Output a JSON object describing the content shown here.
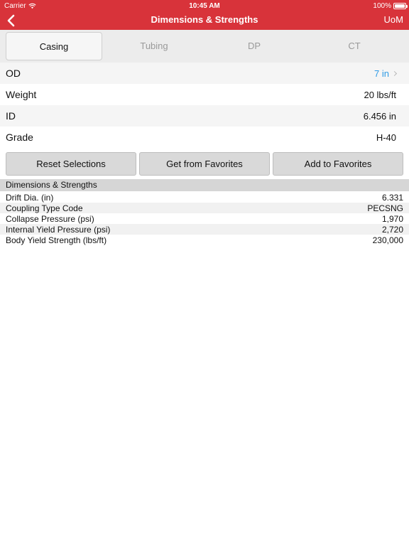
{
  "status_bar": {
    "carrier": "Carrier",
    "time": "10:45 AM",
    "battery": "100%"
  },
  "nav": {
    "title": "Dimensions & Strengths",
    "right_label": "UoM",
    "back_icon": "chevron-left-icon"
  },
  "segments": [
    {
      "label": "Casing",
      "active": true
    },
    {
      "label": "Tubing",
      "active": false
    },
    {
      "label": "DP",
      "active": false
    },
    {
      "label": "CT",
      "active": false
    }
  ],
  "selectors": [
    {
      "label": "OD",
      "value": "7 in"
    },
    {
      "label": "Weight",
      "value": "20 lbs/ft"
    },
    {
      "label": "ID",
      "value": "6.456 in"
    },
    {
      "label": "Grade",
      "value": "H-40"
    }
  ],
  "buttons": {
    "reset": "Reset Selections",
    "get_favorites": "Get from Favorites",
    "add_favorites": "Add to Favorites"
  },
  "results": {
    "header": "Dimensions & Strengths",
    "rows": [
      {
        "label": "Drift Dia. (in)",
        "value": "6.331"
      },
      {
        "label": "Coupling Type Code",
        "value": "PECSNG"
      },
      {
        "label": "Collapse Pressure (psi)",
        "value": "1,970"
      },
      {
        "label": "Internal Yield Pressure (psi)",
        "value": "2,720"
      },
      {
        "label": "Body Yield Strength (lbs/ft)",
        "value": "230,000"
      }
    ]
  },
  "colors": {
    "brand_red": "#d8333a",
    "link_blue": "#2f9be6"
  }
}
